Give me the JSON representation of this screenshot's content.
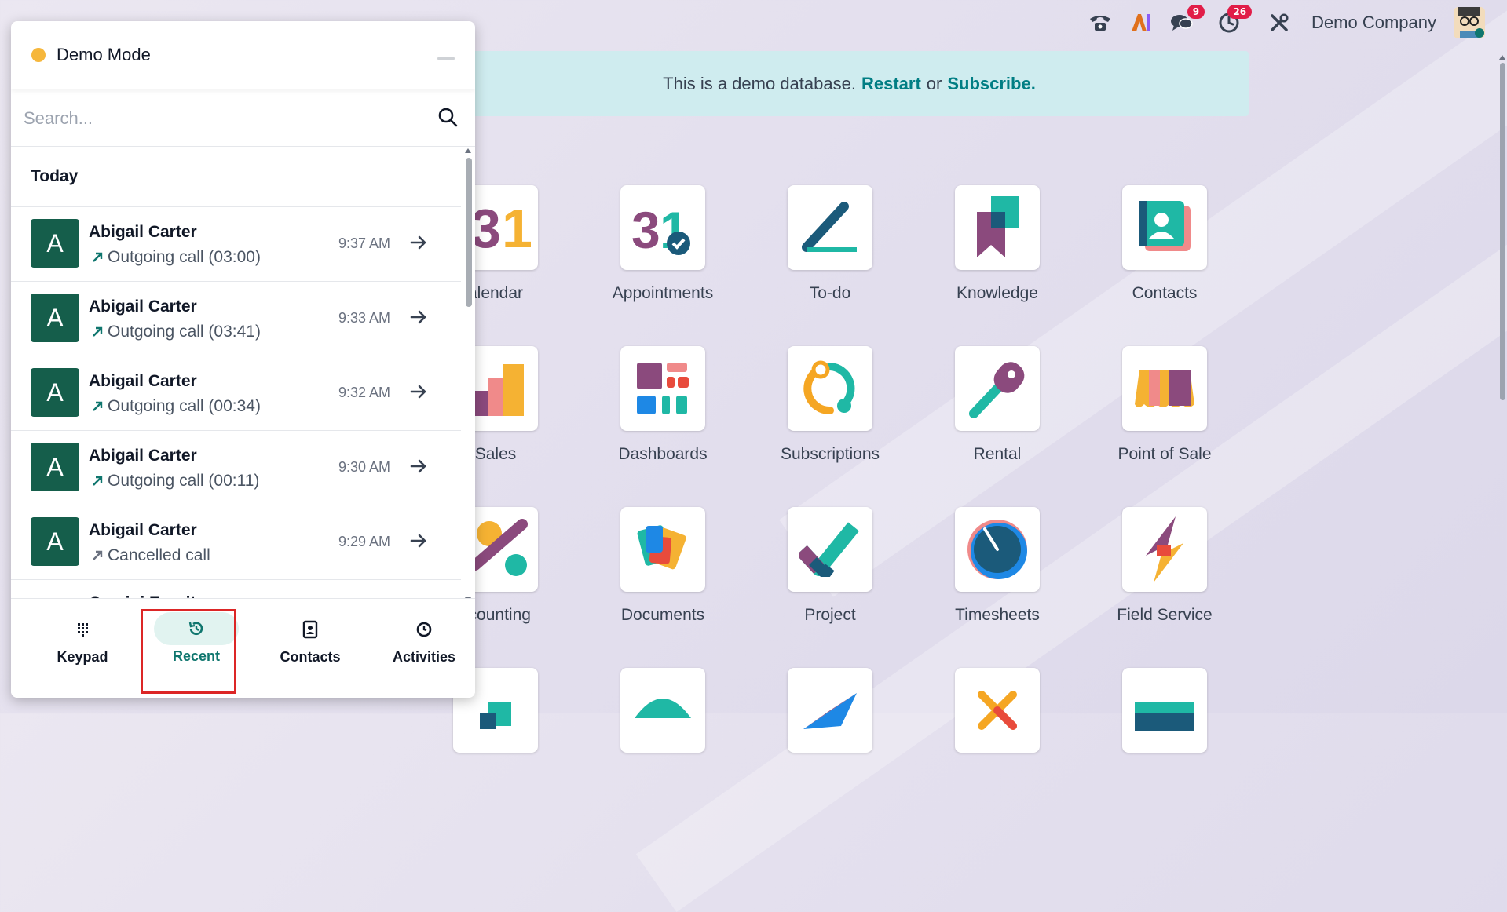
{
  "navbar": {
    "company": "Demo Company",
    "messages_count": "9",
    "activities_count": "26",
    "ai_label": "AI"
  },
  "banner": {
    "text": "This is a demo database.",
    "restart": "Restart",
    "or": "or",
    "subscribe": "Subscribe."
  },
  "apps": [
    {
      "name": "alendar",
      "icon": "calendar-icon"
    },
    {
      "name": "Appointments",
      "icon": "appointments-icon"
    },
    {
      "name": "To-do",
      "icon": "todo-icon"
    },
    {
      "name": "Knowledge",
      "icon": "knowledge-icon"
    },
    {
      "name": "Contacts",
      "icon": "contacts-icon"
    },
    {
      "name": "Sales",
      "icon": "sales-icon"
    },
    {
      "name": "Dashboards",
      "icon": "dashboards-icon"
    },
    {
      "name": "Subscriptions",
      "icon": "subscriptions-icon"
    },
    {
      "name": "Rental",
      "icon": "rental-icon"
    },
    {
      "name": "Point of Sale",
      "icon": "pos-icon"
    },
    {
      "name": "ccounting",
      "icon": "accounting-icon"
    },
    {
      "name": "Documents",
      "icon": "documents-icon"
    },
    {
      "name": "Project",
      "icon": "project-icon"
    },
    {
      "name": "Timesheets",
      "icon": "timesheets-icon"
    },
    {
      "name": "Field Service",
      "icon": "field-service-icon"
    }
  ],
  "softphone": {
    "title": "Demo Mode",
    "search_placeholder": "Search...",
    "section": "Today",
    "calls": [
      {
        "initial": "A",
        "name": "Abigail Carter",
        "status": "Outgoing call (03:00)",
        "time": "9:37 AM"
      },
      {
        "initial": "A",
        "name": "Abigail Carter",
        "status": "Outgoing call (03:41)",
        "time": "9:33 AM"
      },
      {
        "initial": "A",
        "name": "Abigail Carter",
        "status": "Outgoing call (00:34)",
        "time": "9:32 AM"
      },
      {
        "initial": "A",
        "name": "Abigail Carter",
        "status": "Outgoing call (00:11)",
        "time": "9:30 AM"
      },
      {
        "initial": "A",
        "name": "Abigail Carter",
        "status": "Cancelled call",
        "time": "9:29 AM"
      }
    ],
    "partial_name": "Gemini Furniture",
    "tabs": [
      {
        "label": "Keypad"
      },
      {
        "label": "Recent"
      },
      {
        "label": "Contacts"
      },
      {
        "label": "Activities"
      }
    ]
  }
}
